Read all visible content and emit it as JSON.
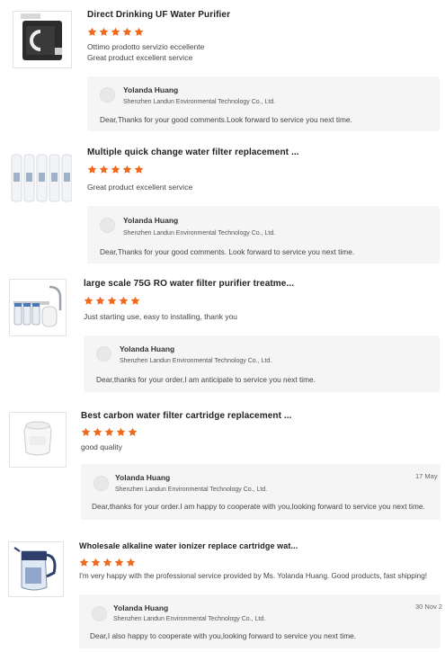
{
  "reviews": [
    {
      "product_title": "Direct Drinking UF Water Purifier",
      "rating": 5,
      "comment_lines": [
        "Ottimo prodotto servizio eccellente",
        "Great product excellent service"
      ],
      "reply": {
        "name": "Yolanda Huang",
        "company": "Shenzhen Landun Environmental Technology Co., Ltd.",
        "date": "",
        "text": "Dear,Thanks for your good comments.Look forward to service you next time."
      }
    },
    {
      "product_title": "Multiple quick change water filter replacement ...",
      "rating": 5,
      "comment_lines": [
        "Great product excellent service"
      ],
      "reply": {
        "name": "Yolanda Huang",
        "company": "Shenzhen Landun Environmental Technology Co., Ltd.",
        "date": "",
        "text": "Dear,Thanks for your good comments. Look forward to service you next time."
      }
    },
    {
      "product_title": "large scale 75G RO water filter purifier treatme...",
      "rating": 5,
      "comment_lines": [
        "Just starting use, easy to installing, thank you"
      ],
      "reply": {
        "name": "Yolanda Huang",
        "company": "Shenzhen Landun Environmental Technology Co., Ltd.",
        "date": "",
        "text": "Dear,thanks for your order,I am anticipate to service you next time."
      }
    },
    {
      "product_title": "Best carbon water filter cartridge replacement ...",
      "rating": 5,
      "comment_lines": [
        "good quality"
      ],
      "reply": {
        "name": "Yolanda Huang",
        "company": "Shenzhen Landun Environmental Technology Co., Ltd.",
        "date": "17 May",
        "text": "Dear,thanks for your order.I am happy to cooperate with you,looking forward to service you next time."
      }
    },
    {
      "product_title": "Wholesale alkaline water ionizer replace cartridge wat...",
      "rating": 5,
      "comment_lines": [
        "I'm very happy with the professional service provided by Ms. Yolanda Huang. Good products, fast shipping!"
      ],
      "reply": {
        "name": "Yolanda Huang",
        "company": "Shenzhen Landun Environmental Technology Co., Ltd.",
        "date": "30 Nov 2",
        "text": "Dear,I also happy to cooperate with you,looking forward to service you next time."
      }
    }
  ],
  "colors": {
    "star": "#f06a1e",
    "reply_bg": "#f5f5f5"
  },
  "icons": {
    "star": "star-icon",
    "avatar": "avatar"
  }
}
